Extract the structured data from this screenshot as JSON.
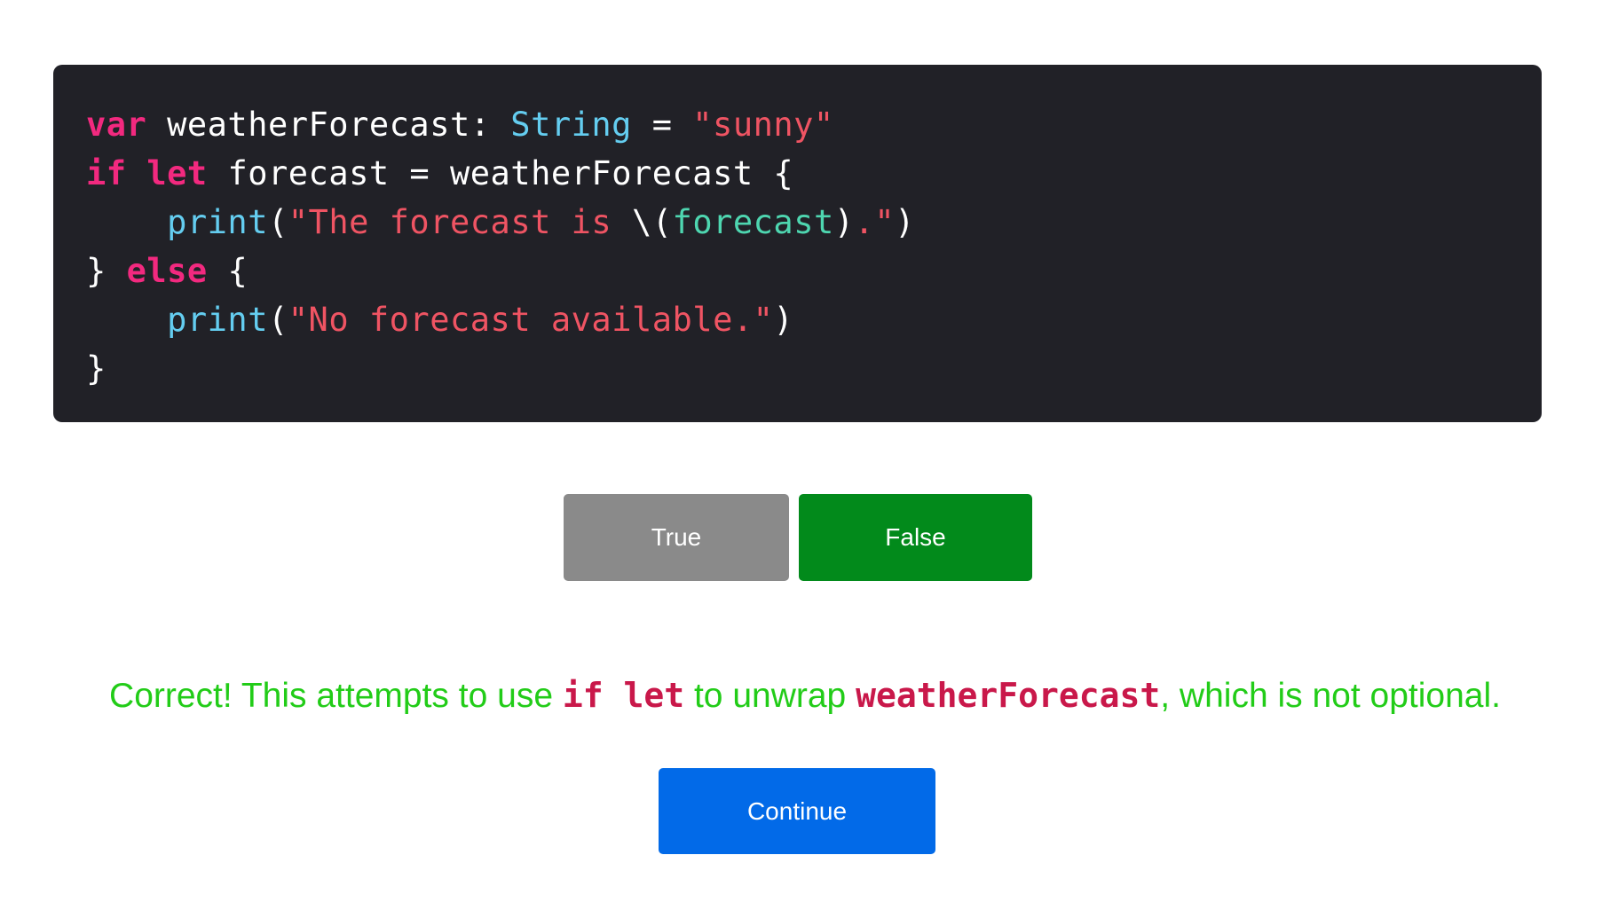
{
  "code": {
    "line1": {
      "kw": "var",
      "name": " weatherForecast: ",
      "type": "String",
      "eq": " = ",
      "str": "\"sunny\""
    },
    "line2": {
      "kw1": "if",
      "sp": " ",
      "kw2": "let",
      "rest": " forecast = weatherForecast {"
    },
    "line3": {
      "indent": "    ",
      "fn": "print",
      "open": "(",
      "str1": "\"The forecast is ",
      "interp_open": "\\(",
      "interp": "forecast",
      "interp_close": ")",
      "str2": ".\"",
      "close": ")"
    },
    "line4": {
      "brace": "} ",
      "kw": "else",
      "rest": " {"
    },
    "line5": {
      "indent": "    ",
      "fn": "print",
      "open": "(",
      "str": "\"No forecast available.\"",
      "close": ")"
    },
    "line6": {
      "brace": "}"
    }
  },
  "answers": {
    "true_label": "True",
    "false_label": "False"
  },
  "feedback": {
    "prefix": "Correct! This attempts to use ",
    "code1": "if let",
    "middle": " to unwrap ",
    "code2": "weatherForecast",
    "suffix": ", which is not optional."
  },
  "continue_label": "Continue",
  "colors": {
    "code_background": "#212127",
    "keyword": "#f2297f",
    "type": "#64cdf0",
    "string": "#ef5463",
    "interpolation": "#4ed6b0",
    "true_button": "#8a8a8a",
    "false_button_selected": "#028a1b",
    "feedback_text": "#22cc18",
    "feedback_code": "#c9184a",
    "continue_button": "#026ae8"
  }
}
